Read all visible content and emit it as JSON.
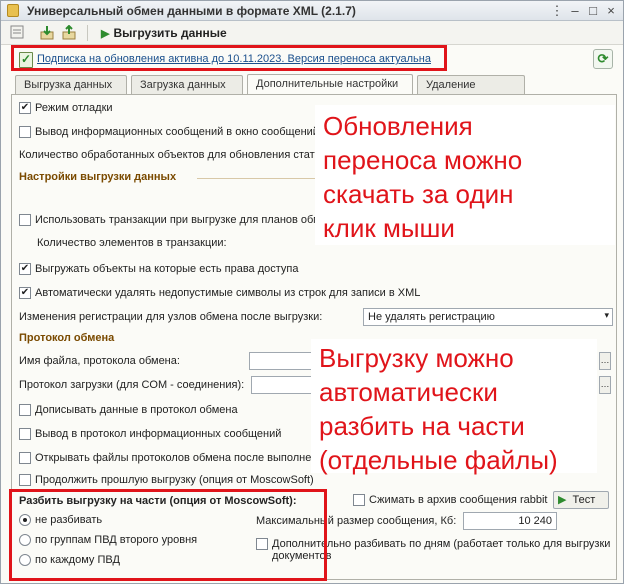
{
  "window": {
    "title": "Универсальный обмен данными в формате XML (2.1.7)",
    "controls": [
      "⋮",
      "–",
      "□",
      "×"
    ]
  },
  "toolbar": {
    "run_label": "Выгрузить данные"
  },
  "subscription": {
    "link_text": "Подписка на обновления активна до 10.11.2023. Версия переноса актуальна"
  },
  "tabs": [
    {
      "label": "Выгрузка данных"
    },
    {
      "label": "Загрузка данных"
    },
    {
      "label": "Дополнительные настройки",
      "active": true
    },
    {
      "label": "Удаление данных"
    }
  ],
  "settings": {
    "debug_mode": {
      "label": "Режим отладки",
      "checked": true
    },
    "info_messages": {
      "label": "Вывод информационных сообщений в окно сообщений",
      "checked": false
    },
    "update_count_label": "Количество обработанных объектов для обновления статуса",
    "export_section": "Настройки выгрузки данных",
    "use_transactions": {
      "label": "Использовать транзакции при выгрузке для планов обмена",
      "checked": false
    },
    "transaction_count_label": "Количество элементов в транзакции:",
    "export_with_rights": {
      "label": "Выгружать объекты на которые есть права доступа",
      "checked": true
    },
    "remove_invalid_chars": {
      "label": "Автоматически удалять недопустимые символы из строк для записи в XML",
      "checked": true
    },
    "registration_change_label": "Изменения регистрации для узлов обмена после выгрузки:",
    "registration_change_value": "Не удалять регистрацию",
    "protocol_section": "Протокол обмена",
    "protocol_file_label": "Имя файла, протокола обмена:",
    "load_protocol_label": "Протокол загрузки (для COM - соединения):",
    "append_protocol": {
      "label": "Дописывать данные в протокол обмена",
      "checked": false
    },
    "protocol_info": {
      "label": "Вывод в протокол информационных сообщений",
      "checked": false
    },
    "open_protocol_files": {
      "label": "Открывать файлы протоколов обмена после выполнения",
      "checked": false
    },
    "continue_export": {
      "label": "Продолжить прошлую выгрузку (опция от MoscowSoft)",
      "checked": false
    },
    "split_section": "Разбить выгрузку на части (опция от MoscowSoft):",
    "split_options": [
      {
        "label": "не разбивать",
        "selected": true
      },
      {
        "label": "по группам ПВД второго уровня",
        "selected": false
      },
      {
        "label": "по каждому ПВД",
        "selected": false
      }
    ],
    "compress_rabbit": {
      "label": "Сжимать в архив сообщения rabbit M",
      "checked": false
    },
    "test_label": "Тест",
    "max_size_label": "Максимальный размер сообщения, Кб:",
    "max_size_value": "10 240",
    "split_by_days": {
      "label": "Дополнительно разбивать по дням (работает только для выгрузки документов",
      "checked": false
    }
  },
  "annotations": {
    "callout_top": [
      "Обновления",
      "переноса можно",
      "скачать за один",
      "клик мыши"
    ],
    "callout_bottom": [
      "Выгрузку можно",
      "автоматически",
      "разбить на части",
      "(отдельные файлы)"
    ],
    "accent_color": "#e0141a"
  }
}
